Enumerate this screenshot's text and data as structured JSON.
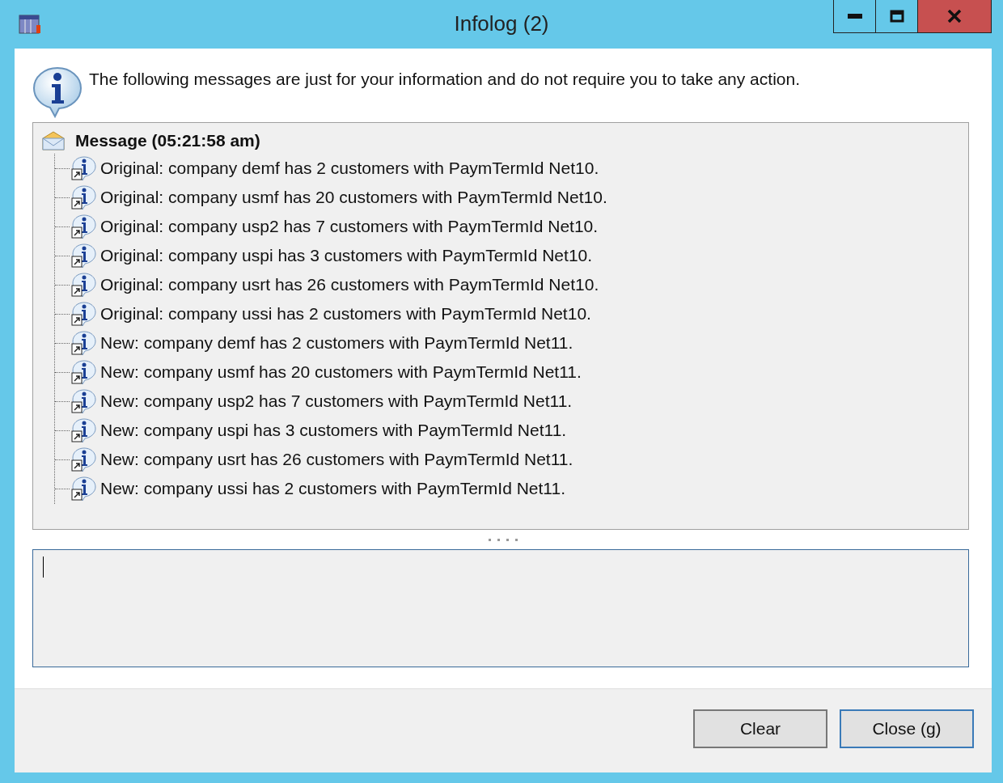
{
  "window": {
    "title": "Infolog (2)"
  },
  "info_message": "The following messages are just for your information and do not require you to take any action.",
  "tree": {
    "label": "Message (05:21:58 am)",
    "expanded": true,
    "children": [
      {
        "text": "Original: company demf has 2 customers with PaymTermId Net10."
      },
      {
        "text": "Original: company usmf has 20 customers with PaymTermId Net10."
      },
      {
        "text": "Original: company usp2 has 7 customers with PaymTermId Net10."
      },
      {
        "text": "Original: company uspi has 3 customers with PaymTermId Net10."
      },
      {
        "text": "Original: company usrt has 26 customers with PaymTermId Net10."
      },
      {
        "text": "Original: company ussi has 2 customers with PaymTermId Net10."
      },
      {
        "text": "New: company demf has 2 customers with PaymTermId Net11."
      },
      {
        "text": "New: company usmf has 20 customers with PaymTermId Net11."
      },
      {
        "text": "New: company usp2 has 7 customers with PaymTermId Net11."
      },
      {
        "text": "New: company uspi has 3 customers with PaymTermId Net11."
      },
      {
        "text": "New: company usrt has 26 customers with PaymTermId Net11."
      },
      {
        "text": "New: company ussi has 2 customers with PaymTermId Net11."
      }
    ]
  },
  "buttons": [
    {
      "label": "Clear",
      "focused": false
    },
    {
      "label": "Close (g)",
      "focused": true
    }
  ]
}
